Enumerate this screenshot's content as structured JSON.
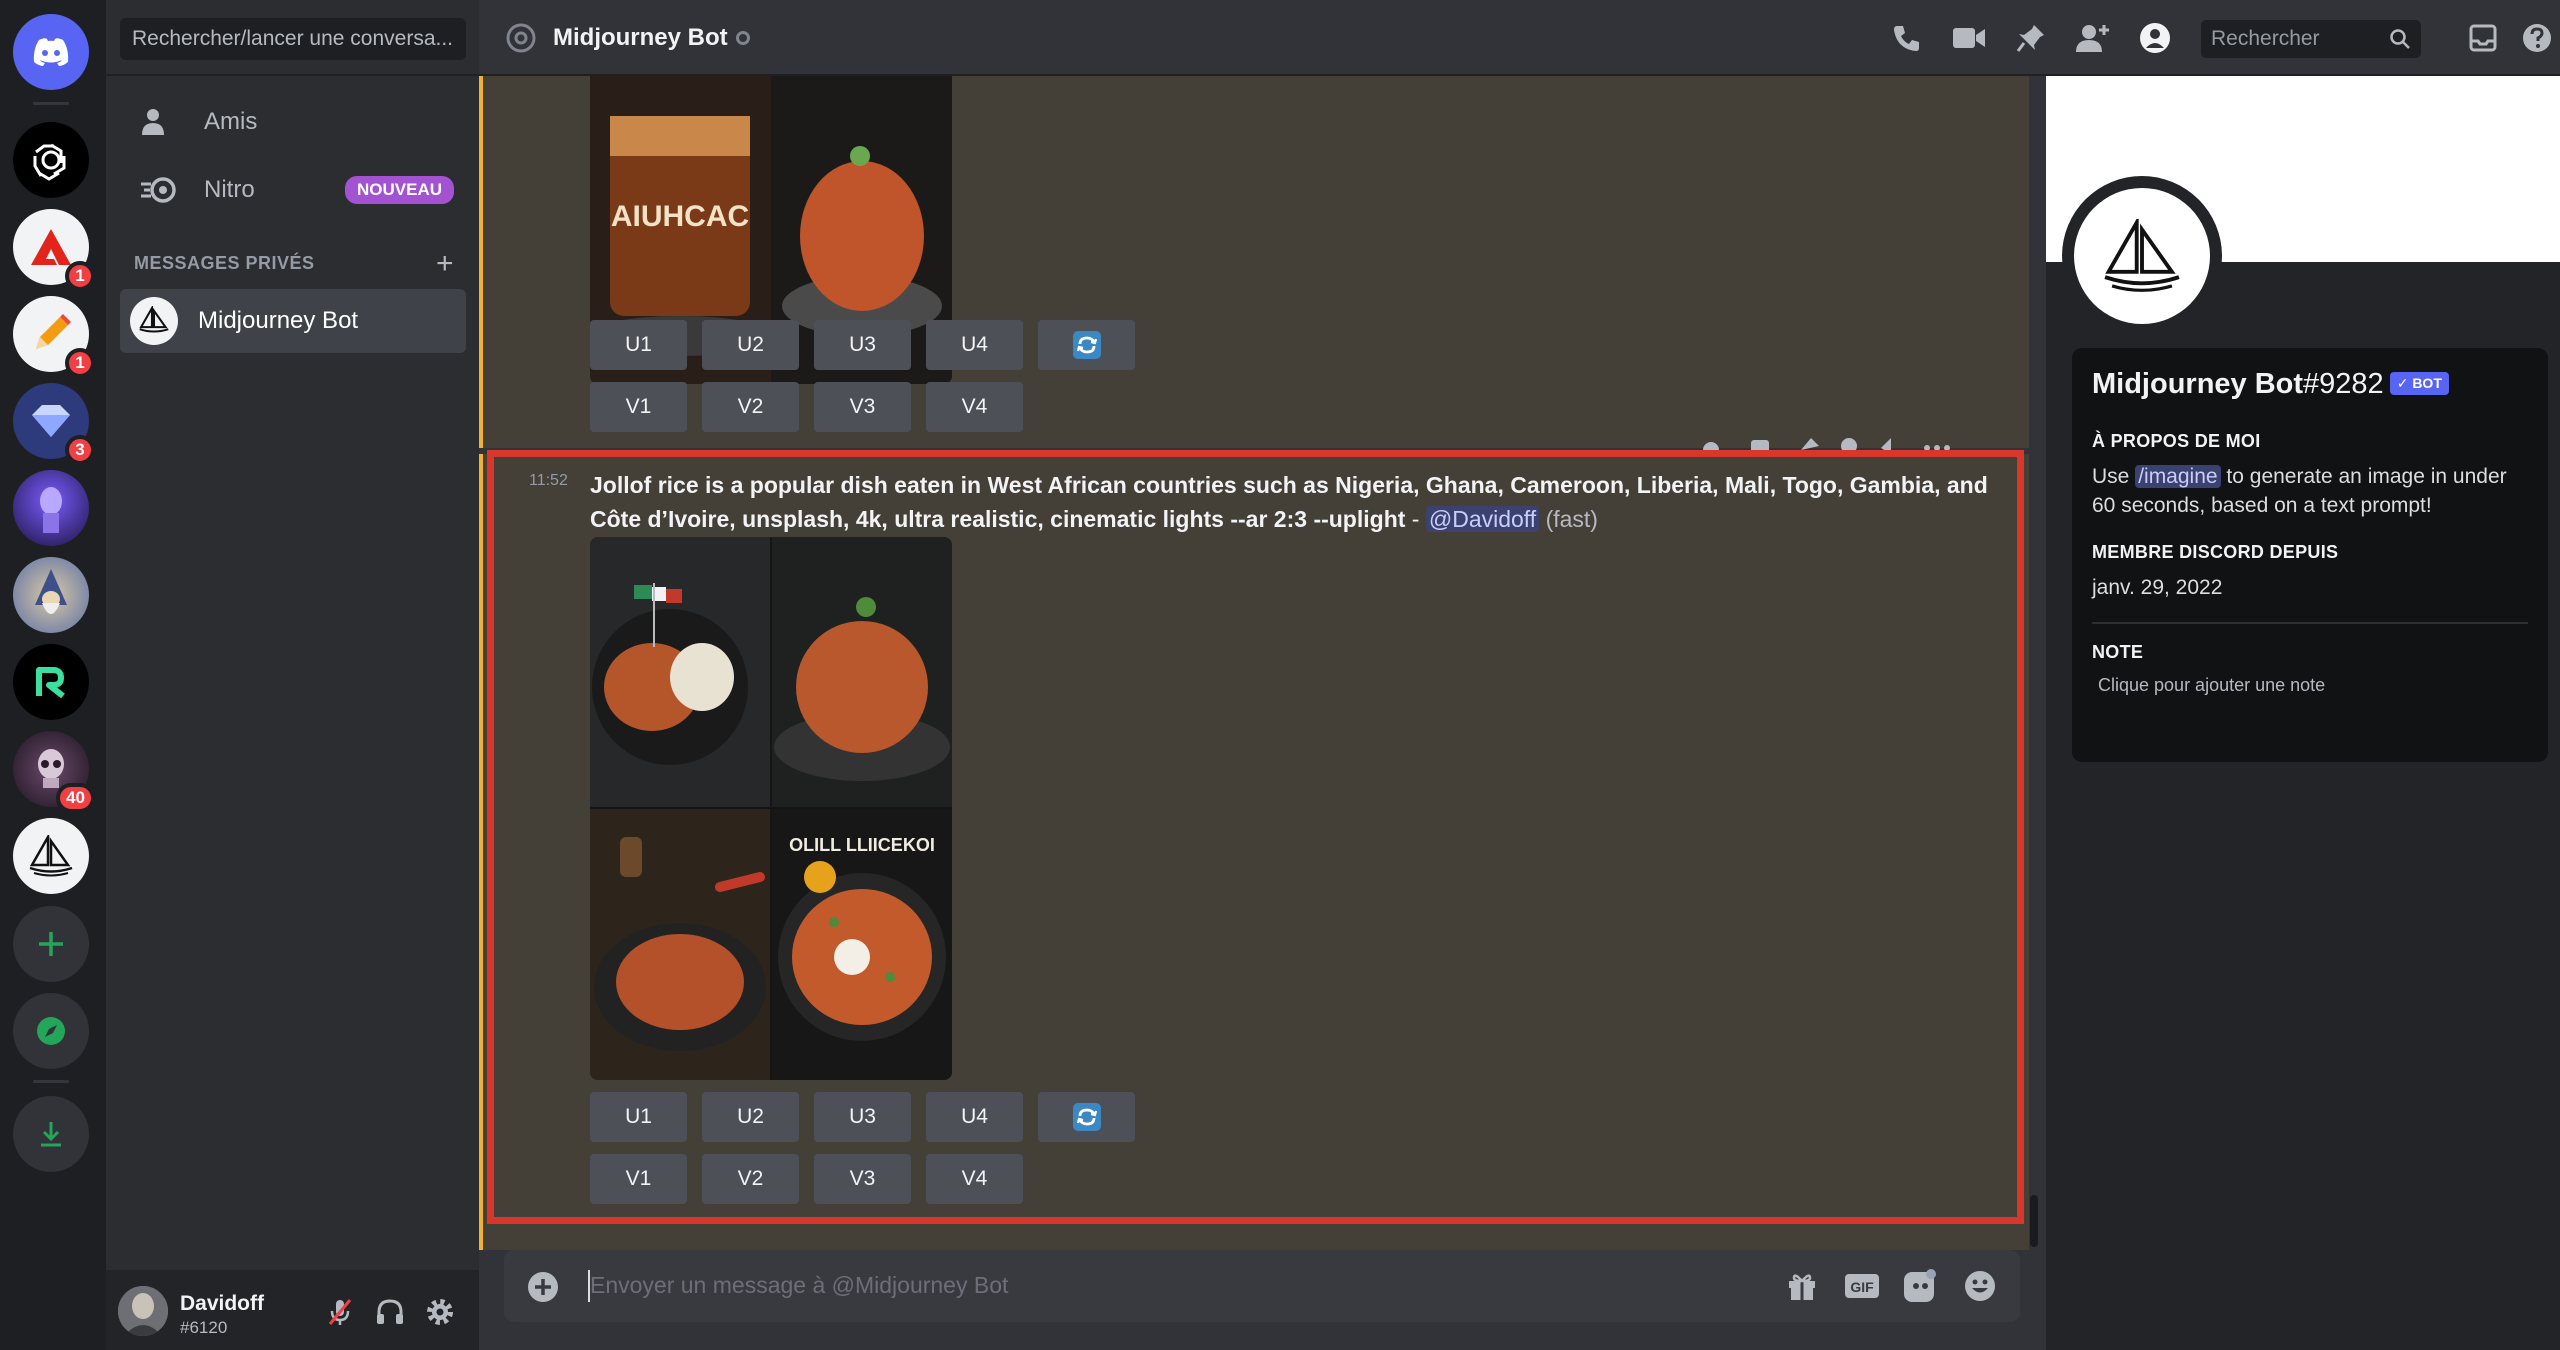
{
  "search_dm": {
    "placeholder": "Rechercher/lancer une conversa..."
  },
  "nav": {
    "friends_label": "Amis",
    "nitro_label": "Nitro",
    "nitro_badge": "NOUVEAU"
  },
  "dm_section": {
    "title": "MESSAGES PRIVÉS",
    "items": [
      {
        "label": "Midjourney Bot"
      }
    ]
  },
  "servers": {
    "badges": {
      "s2": "1",
      "s3": "1",
      "s4": "3",
      "s8": "40"
    }
  },
  "user": {
    "name": "Davidoff",
    "tag": "#6120"
  },
  "header": {
    "title": "Midjourney Bot",
    "search_placeholder": "Rechercher"
  },
  "messages": {
    "top_buttons_u": [
      "U1",
      "U2",
      "U3",
      "U4"
    ],
    "top_buttons_v": [
      "V1",
      "V2",
      "V3",
      "V4"
    ],
    "main": {
      "time": "11:52",
      "prompt": "Jollof rice is a popular dish eaten in West African countries such as Nigeria, Ghana, Cameroon, Liberia, Mali, Togo, Gambia, and Côte d’Ivoire, unsplash, 4k, ultra realistic, cinematic lights --ar 2:3 --uplight",
      "separator": " - ",
      "mention": "@Davidoff",
      "speed": "(fast)",
      "buttons_u": [
        "U1",
        "U2",
        "U3",
        "U4"
      ],
      "buttons_v": [
        "V1",
        "V2",
        "V3",
        "V4"
      ],
      "grid_overlay_text": "OLILL LLIICEKOI",
      "top_image_text": "AIUHCAC"
    }
  },
  "composer": {
    "placeholder": "Envoyer un message à @Midjourney Bot"
  },
  "profile": {
    "name": "Midjourney Bot",
    "discriminator": "#9282",
    "badge": "✓ BOT",
    "about_title": "À PROPOS DE MOI",
    "about_pre": "Use ",
    "about_cmd": "/imagine",
    "about_post": " to generate an image in under 60 seconds, based on a text prompt!",
    "member_title": "MEMBRE DISCORD DEPUIS",
    "member_since": "janv. 29, 2022",
    "note_title": "NOTE",
    "note_placeholder": "Clique pour ajouter une note"
  },
  "colors": {
    "accent": "#5865f2",
    "highlight_border": "#d9372b",
    "mention_bar": "#f0b232",
    "nitro": "#a352d1",
    "badge_red": "#f23f43"
  }
}
